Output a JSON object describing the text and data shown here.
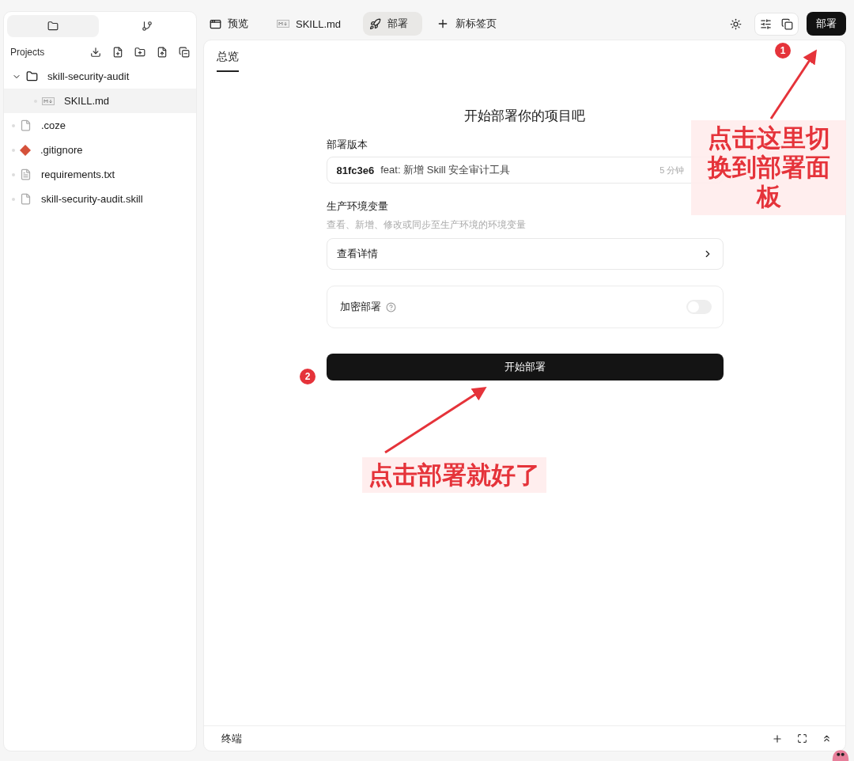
{
  "sidebar": {
    "tabs": [
      {
        "selected": true
      },
      {
        "selected": false
      }
    ],
    "title": "Projects",
    "tree": [
      {
        "name": "skill-security-audit",
        "kind": "folder",
        "expanded": true,
        "selected": false,
        "children": [
          {
            "name": "SKILL.md",
            "kind": "markdown",
            "selected": true
          }
        ]
      },
      {
        "name": ".coze",
        "kind": "file",
        "selected": false
      },
      {
        "name": ".gitignore",
        "kind": "git",
        "selected": false
      },
      {
        "name": "requirements.txt",
        "kind": "text",
        "selected": false
      },
      {
        "name": "skill-security-audit.skill",
        "kind": "file",
        "selected": false
      }
    ]
  },
  "tabs": [
    {
      "label": "预览",
      "kind": "preview",
      "selected": false
    },
    {
      "label": "SKILL.md",
      "kind": "markdown",
      "selected": false
    },
    {
      "label": "部署",
      "kind": "deploy",
      "selected": true
    },
    {
      "label": "新标签页",
      "kind": "new",
      "selected": false
    }
  ],
  "deploy_button": "部署",
  "panel": {
    "tab": "总览",
    "heading": "开始部署你的项目吧",
    "version_label": "部署版本",
    "version": {
      "hash": "81fc3e6",
      "message": "feat: 新增 Skill 安全审计工具",
      "time": "5 分钟"
    },
    "env_label": "生产环境变量",
    "env_hint": "查看、新增、修改或同步至生产环境的环境变量",
    "env_link": "查看详情",
    "encrypt_label": "加密部署",
    "encrypt_on": false,
    "start_button": "开始部署"
  },
  "terminal": {
    "label": "终端"
  },
  "annotations": [
    {
      "marker": "1",
      "text": "点击这里切换到部署面板"
    },
    {
      "marker": "2",
      "text": "点击部署就好了"
    }
  ]
}
